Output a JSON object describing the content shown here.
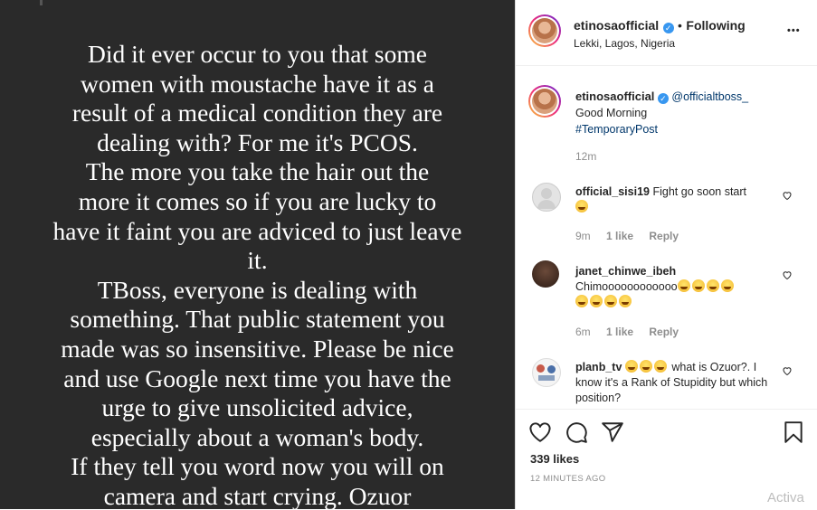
{
  "post": {
    "story_lines": [
      "Did it ever occur to you that some",
      "women with moustache have it as a",
      "result of a medical condition they are",
      "dealing with? For me it's PCOS.",
      "The more you take the hair out the",
      "more it comes so if you are lucky to",
      "have it faint you are adviced to just leave",
      "it.",
      "TBoss, everyone is dealing with",
      "something. That public statement you",
      "made was so insensitive. Please be nice",
      "and use Google next time you have the",
      "urge to give unsolicited advice,",
      "especially about a woman's body.",
      "If they tell you word now you will on",
      "camera and start crying. Ozuor"
    ]
  },
  "header": {
    "username": "etinosaofficial",
    "verified_mark": "✓",
    "separator": "•",
    "follow_status": "Following",
    "location": "Lekki, Lagos, Nigeria",
    "more_label": "•••"
  },
  "caption": {
    "username": "etinosaofficial",
    "mention": "@officialtboss_",
    "text": "Good Morning",
    "hashtag": "#TemporaryPost",
    "time": "12m"
  },
  "comments": [
    {
      "username": "official_sisi19",
      "text": "Fight go soon start",
      "emoji_count": 1,
      "time": "9m",
      "likes": "1 like",
      "reply": "Reply"
    },
    {
      "username": "janet_chinwe_ibeh",
      "text": "Chimoooooooooooo",
      "emoji_count": 8,
      "time": "6m",
      "likes": "1 like",
      "reply": "Reply"
    },
    {
      "username": "planb_tv",
      "text_before": "",
      "emoji_count": 3,
      "text": "what is Ozuor?. I know it's a Rank of Stupidity but which position?"
    }
  ],
  "actions": {
    "icons": [
      "heart-icon",
      "comment-icon",
      "share-icon",
      "bookmark-icon"
    ],
    "likes": "339 likes",
    "timestamp": "12 MINUTES AGO"
  },
  "watermark": "Activa",
  "colors": {
    "post_bg": "#2a2a2a",
    "link": "#00376b",
    "verified": "#3897f0",
    "muted": "#8e8e8e"
  }
}
